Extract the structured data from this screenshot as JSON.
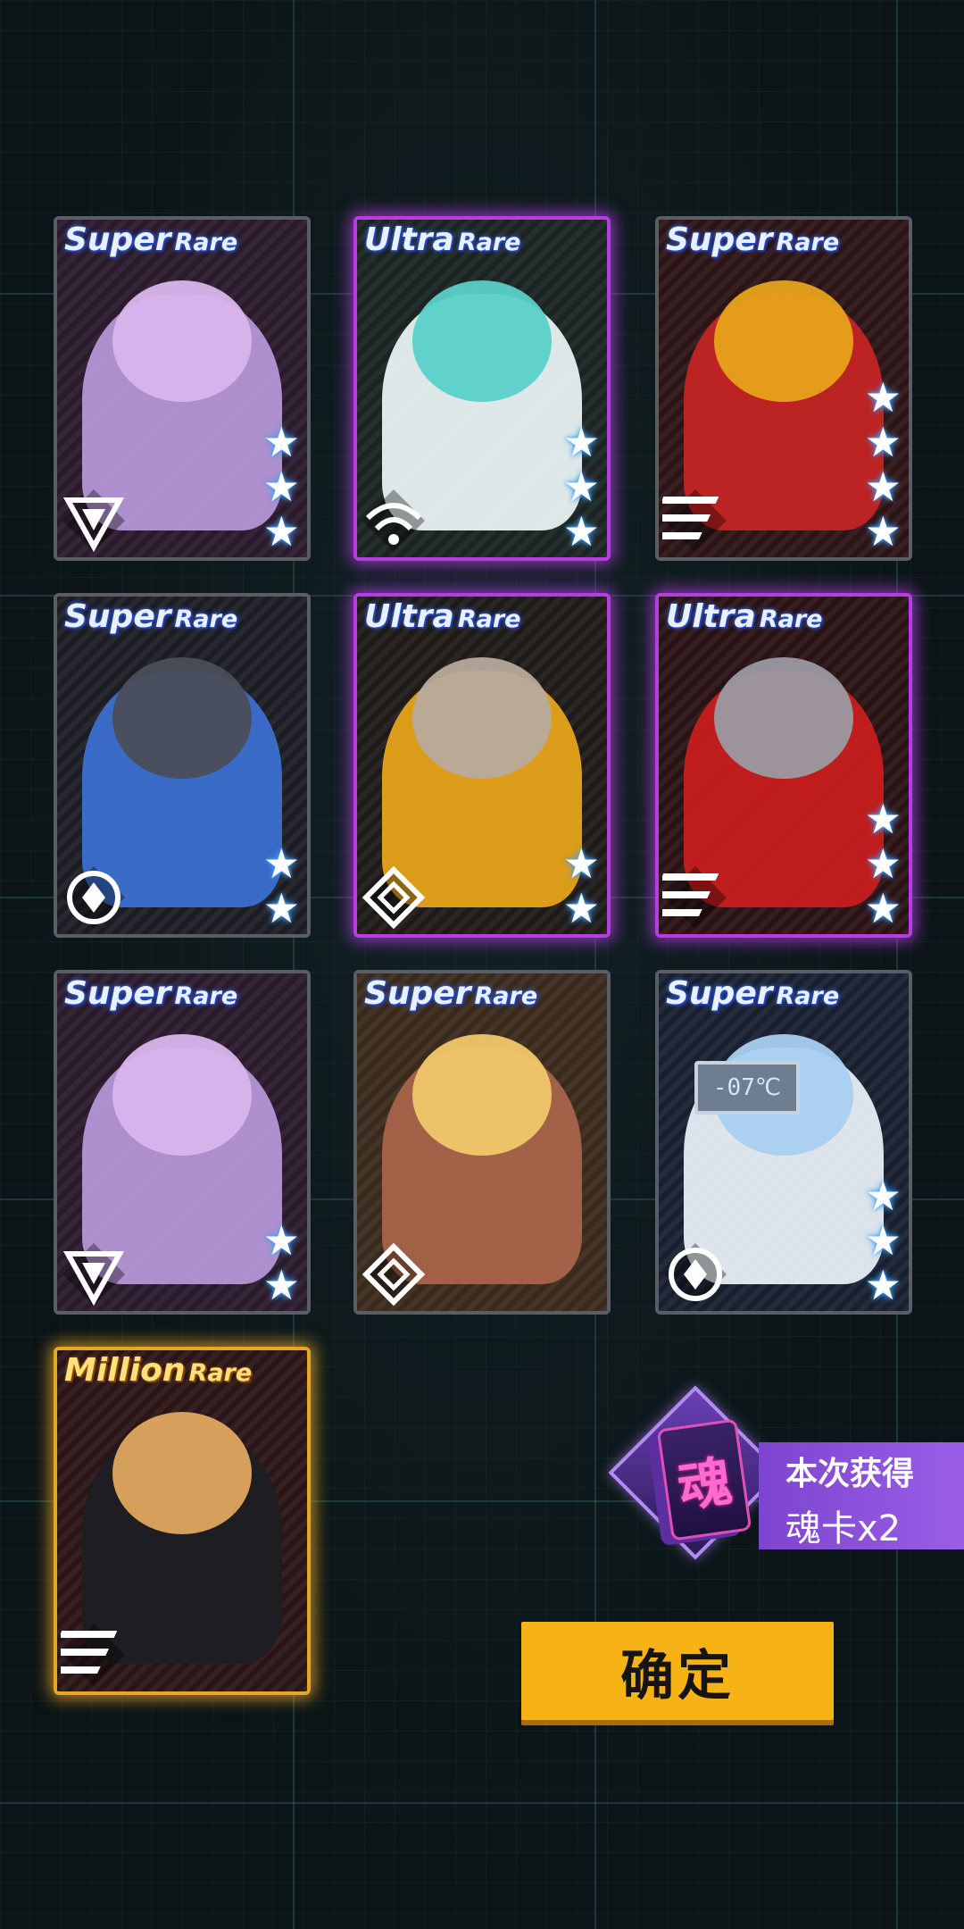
{
  "cards": [
    {
      "rarity_word1": "Super",
      "rarity_word2": "Rare",
      "tier": "sr",
      "stars": 3,
      "class_icon": "triangle-class-icon",
      "colors": {
        "bg": "#2a1a2c",
        "figure": "#b596d6",
        "head": "#d8b6ec"
      }
    },
    {
      "rarity_word1": "Ultra",
      "rarity_word2": "Rare",
      "tier": "ur",
      "stars": 3,
      "class_icon": "wifi-class-icon",
      "colors": {
        "bg": "#1b2422",
        "figure": "#e8f2f2",
        "head": "#59d1c9"
      }
    },
    {
      "rarity_word1": "Super",
      "rarity_word2": "Rare",
      "tier": "sr",
      "stars": 4,
      "class_icon": "stripes-class-icon",
      "colors": {
        "bg": "#2c1416",
        "figure": "#c42424",
        "head": "#e6a31a"
      }
    },
    {
      "rarity_word1": "Super",
      "rarity_word2": "Rare",
      "tier": "sr",
      "stars": 2,
      "class_icon": "circle-class-icon",
      "colors": {
        "bg": "#1c1c24",
        "figure": "#3a6fd0",
        "head": "#4a4e58"
      }
    },
    {
      "rarity_word1": "Ultra",
      "rarity_word2": "Rare",
      "tier": "ur",
      "stars": 2,
      "class_icon": "diamond-class-icon",
      "colors": {
        "bg": "#1e1a18",
        "figure": "#e6a31a",
        "head": "#b7aa9c"
      }
    },
    {
      "rarity_word1": "Ultra",
      "rarity_word2": "Rare",
      "tier": "ur",
      "stars": 3,
      "class_icon": "stripes-class-icon",
      "colors": {
        "bg": "#2a1214",
        "figure": "#c81e1e",
        "head": "#9a9aa2"
      }
    },
    {
      "rarity_word1": "Super",
      "rarity_word2": "Rare",
      "tier": "sr",
      "stars": 2,
      "class_icon": "triangle-class-icon",
      "colors": {
        "bg": "#2a1a2c",
        "figure": "#b596d6",
        "head": "#d8b6ec"
      }
    },
    {
      "rarity_word1": "Super",
      "rarity_word2": "Rare",
      "tier": "sr",
      "stars": 0,
      "class_icon": "diamond-class-icon",
      "colors": {
        "bg": "#3a2a1c",
        "figure": "#a8644a",
        "head": "#f0c86a"
      }
    },
    {
      "rarity_word1": "Super",
      "rarity_word2": "Rare",
      "tier": "sr",
      "stars": 3,
      "class_icon": "circle-class-icon",
      "colors": {
        "bg": "#182030",
        "figure": "#e8eef4",
        "head": "#a9cff0"
      }
    },
    {
      "rarity_word1": "Million",
      "rarity_word2": "Rare",
      "tier": "mr",
      "stars": 0,
      "class_icon": "stripes-class-icon",
      "colors": {
        "bg": "#2a1416",
        "figure": "#1e1e22",
        "head": "#e0a860"
      }
    }
  ],
  "fridge_display": "-07℃",
  "soul_badge": {
    "icon_char": "魂",
    "label": "本次获得",
    "reward": "魂卡x2"
  },
  "confirm_button": {
    "label": "确定"
  },
  "colors": {
    "ultra_glow": "#b73de0",
    "million_glow": "#e6a62a",
    "confirm": "#f7b216",
    "soul_panel": "#8a52dc"
  }
}
